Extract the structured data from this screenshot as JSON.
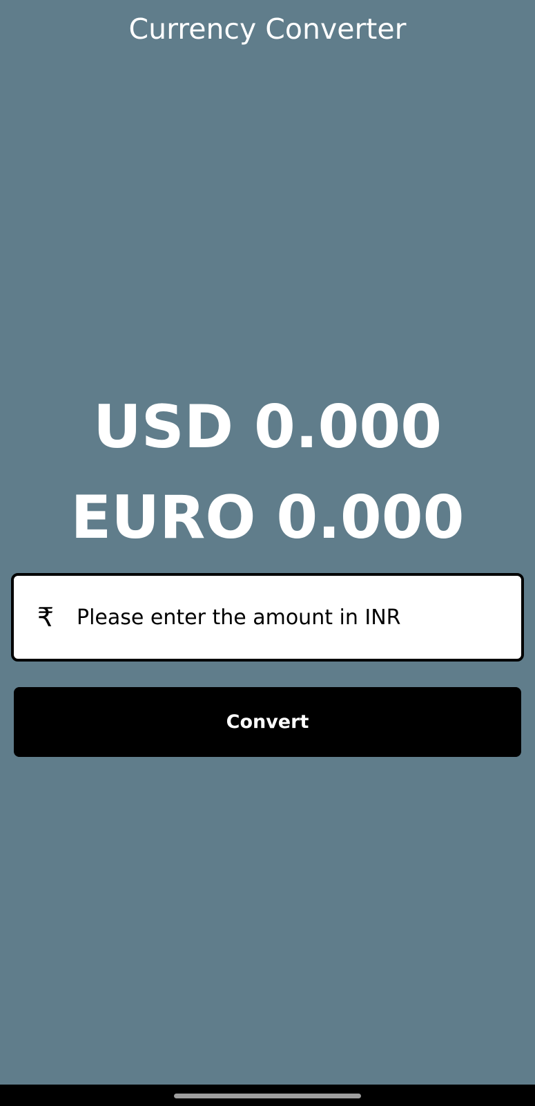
{
  "app_bar": {
    "title": "Currency Converter"
  },
  "results": {
    "usd": "USD 0.000",
    "euro": "EURO 0.000"
  },
  "amount_field": {
    "icon": "rupee-icon",
    "icon_glyph": "₹",
    "placeholder": "Please enter the amount in INR",
    "value": ""
  },
  "convert_button": {
    "label": "Convert"
  },
  "colors": {
    "background": "#607d8b",
    "text": "#ffffff",
    "button": "#000000",
    "field_border": "#000000"
  }
}
